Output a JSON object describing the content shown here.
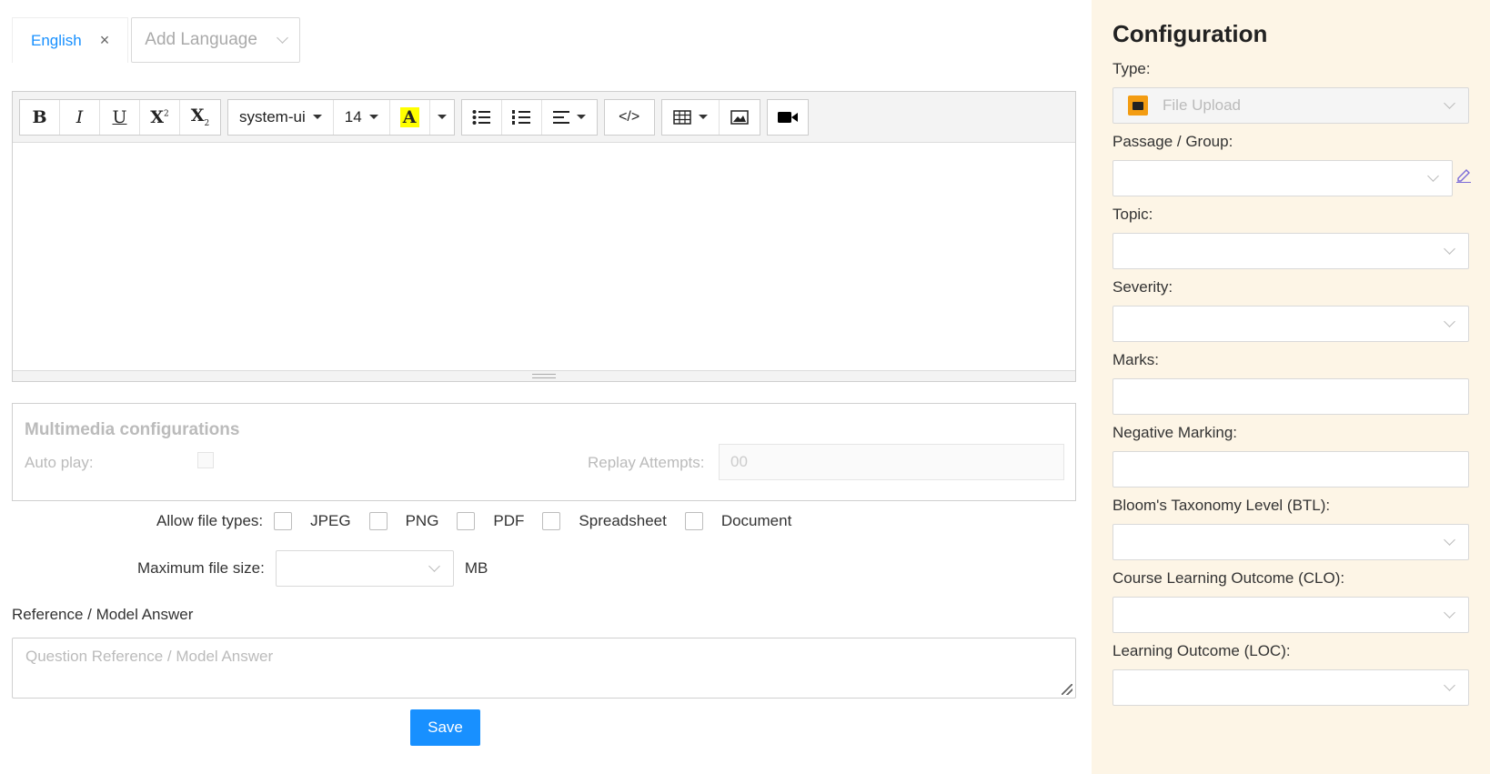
{
  "languages": {
    "active": "English",
    "close_glyph": "×",
    "add_placeholder": "Add Language"
  },
  "toolbar": {
    "bold": "B",
    "italic": "I",
    "underline": "U",
    "superscript": "X",
    "subscript": "X",
    "font_family": "system-ui",
    "font_size": "14",
    "highlight": "A",
    "code": "</>"
  },
  "multimedia": {
    "title": "Multimedia configurations",
    "auto_play_label": "Auto play:",
    "replay_label": "Replay Attempts:",
    "replay_value": "00"
  },
  "file_types": {
    "label": "Allow file types:",
    "options": [
      "JPEG",
      "PNG",
      "PDF",
      "Spreadsheet",
      "Document"
    ]
  },
  "max_size": {
    "label": "Maximum file size:",
    "unit": "MB"
  },
  "reference": {
    "label": "Reference / Model Answer",
    "placeholder": "Question Reference / Model Answer"
  },
  "save_label": "Save",
  "config": {
    "title": "Configuration",
    "type_label": "Type:",
    "type_value": "File Upload",
    "passage_label": "Passage / Group:",
    "topic_label": "Topic:",
    "severity_label": "Severity:",
    "marks_label": "Marks:",
    "negative_label": "Negative Marking:",
    "btl_label": "Bloom's Taxonomy Level (BTL):",
    "clo_label": "Course Learning Outcome (CLO):",
    "loc_label": "Learning Outcome (LOC):"
  },
  "colors": {
    "accent": "#1890ff",
    "panel_bg": "#fdf5e6",
    "folder": "#f39c12",
    "highlight": "#ffff00"
  }
}
